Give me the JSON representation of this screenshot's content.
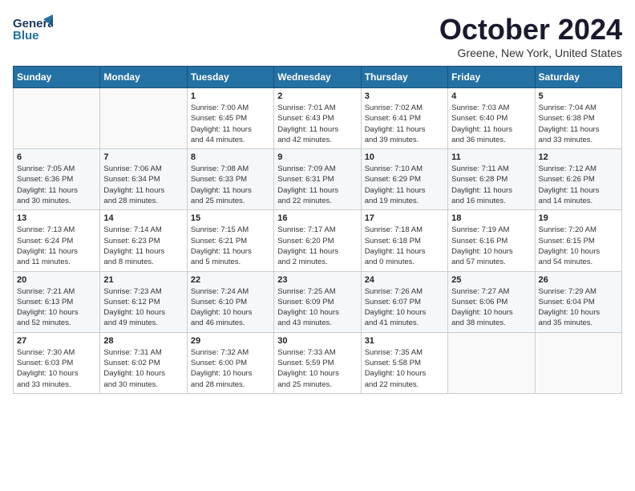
{
  "header": {
    "logo_line1": "General",
    "logo_line2": "Blue",
    "month_title": "October 2024",
    "location": "Greene, New York, United States"
  },
  "weekdays": [
    "Sunday",
    "Monday",
    "Tuesday",
    "Wednesday",
    "Thursday",
    "Friday",
    "Saturday"
  ],
  "weeks": [
    [
      {
        "num": "",
        "info": ""
      },
      {
        "num": "",
        "info": ""
      },
      {
        "num": "1",
        "info": "Sunrise: 7:00 AM\nSunset: 6:45 PM\nDaylight: 11 hours\nand 44 minutes."
      },
      {
        "num": "2",
        "info": "Sunrise: 7:01 AM\nSunset: 6:43 PM\nDaylight: 11 hours\nand 42 minutes."
      },
      {
        "num": "3",
        "info": "Sunrise: 7:02 AM\nSunset: 6:41 PM\nDaylight: 11 hours\nand 39 minutes."
      },
      {
        "num": "4",
        "info": "Sunrise: 7:03 AM\nSunset: 6:40 PM\nDaylight: 11 hours\nand 36 minutes."
      },
      {
        "num": "5",
        "info": "Sunrise: 7:04 AM\nSunset: 6:38 PM\nDaylight: 11 hours\nand 33 minutes."
      }
    ],
    [
      {
        "num": "6",
        "info": "Sunrise: 7:05 AM\nSunset: 6:36 PM\nDaylight: 11 hours\nand 30 minutes."
      },
      {
        "num": "7",
        "info": "Sunrise: 7:06 AM\nSunset: 6:34 PM\nDaylight: 11 hours\nand 28 minutes."
      },
      {
        "num": "8",
        "info": "Sunrise: 7:08 AM\nSunset: 6:33 PM\nDaylight: 11 hours\nand 25 minutes."
      },
      {
        "num": "9",
        "info": "Sunrise: 7:09 AM\nSunset: 6:31 PM\nDaylight: 11 hours\nand 22 minutes."
      },
      {
        "num": "10",
        "info": "Sunrise: 7:10 AM\nSunset: 6:29 PM\nDaylight: 11 hours\nand 19 minutes."
      },
      {
        "num": "11",
        "info": "Sunrise: 7:11 AM\nSunset: 6:28 PM\nDaylight: 11 hours\nand 16 minutes."
      },
      {
        "num": "12",
        "info": "Sunrise: 7:12 AM\nSunset: 6:26 PM\nDaylight: 11 hours\nand 14 minutes."
      }
    ],
    [
      {
        "num": "13",
        "info": "Sunrise: 7:13 AM\nSunset: 6:24 PM\nDaylight: 11 hours\nand 11 minutes."
      },
      {
        "num": "14",
        "info": "Sunrise: 7:14 AM\nSunset: 6:23 PM\nDaylight: 11 hours\nand 8 minutes."
      },
      {
        "num": "15",
        "info": "Sunrise: 7:15 AM\nSunset: 6:21 PM\nDaylight: 11 hours\nand 5 minutes."
      },
      {
        "num": "16",
        "info": "Sunrise: 7:17 AM\nSunset: 6:20 PM\nDaylight: 11 hours\nand 2 minutes."
      },
      {
        "num": "17",
        "info": "Sunrise: 7:18 AM\nSunset: 6:18 PM\nDaylight: 11 hours\nand 0 minutes."
      },
      {
        "num": "18",
        "info": "Sunrise: 7:19 AM\nSunset: 6:16 PM\nDaylight: 10 hours\nand 57 minutes."
      },
      {
        "num": "19",
        "info": "Sunrise: 7:20 AM\nSunset: 6:15 PM\nDaylight: 10 hours\nand 54 minutes."
      }
    ],
    [
      {
        "num": "20",
        "info": "Sunrise: 7:21 AM\nSunset: 6:13 PM\nDaylight: 10 hours\nand 52 minutes."
      },
      {
        "num": "21",
        "info": "Sunrise: 7:23 AM\nSunset: 6:12 PM\nDaylight: 10 hours\nand 49 minutes."
      },
      {
        "num": "22",
        "info": "Sunrise: 7:24 AM\nSunset: 6:10 PM\nDaylight: 10 hours\nand 46 minutes."
      },
      {
        "num": "23",
        "info": "Sunrise: 7:25 AM\nSunset: 6:09 PM\nDaylight: 10 hours\nand 43 minutes."
      },
      {
        "num": "24",
        "info": "Sunrise: 7:26 AM\nSunset: 6:07 PM\nDaylight: 10 hours\nand 41 minutes."
      },
      {
        "num": "25",
        "info": "Sunrise: 7:27 AM\nSunset: 6:06 PM\nDaylight: 10 hours\nand 38 minutes."
      },
      {
        "num": "26",
        "info": "Sunrise: 7:29 AM\nSunset: 6:04 PM\nDaylight: 10 hours\nand 35 minutes."
      }
    ],
    [
      {
        "num": "27",
        "info": "Sunrise: 7:30 AM\nSunset: 6:03 PM\nDaylight: 10 hours\nand 33 minutes."
      },
      {
        "num": "28",
        "info": "Sunrise: 7:31 AM\nSunset: 6:02 PM\nDaylight: 10 hours\nand 30 minutes."
      },
      {
        "num": "29",
        "info": "Sunrise: 7:32 AM\nSunset: 6:00 PM\nDaylight: 10 hours\nand 28 minutes."
      },
      {
        "num": "30",
        "info": "Sunrise: 7:33 AM\nSunset: 5:59 PM\nDaylight: 10 hours\nand 25 minutes."
      },
      {
        "num": "31",
        "info": "Sunrise: 7:35 AM\nSunset: 5:58 PM\nDaylight: 10 hours\nand 22 minutes."
      },
      {
        "num": "",
        "info": ""
      },
      {
        "num": "",
        "info": ""
      }
    ]
  ]
}
